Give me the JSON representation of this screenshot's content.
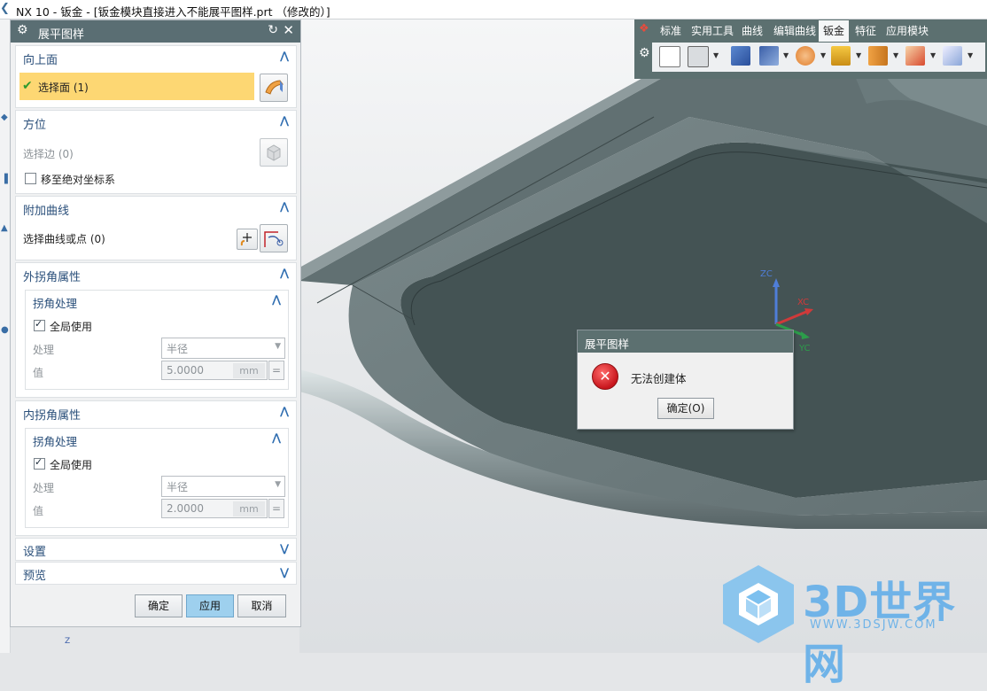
{
  "window": {
    "title": "NX 10 - 钣金 - [钣金模块直接进入不能展平图样.prt （修改的）]"
  },
  "dialog": {
    "title": "展平图样",
    "sections": {
      "up_face": {
        "label": "向上面",
        "select_label": "选择面 (1)"
      },
      "orientation": {
        "label": "方位",
        "select_edge": "选择边 (0)",
        "move_abs": "移至绝对坐标系"
      },
      "extra_curves": {
        "label": "附加曲线",
        "select_curve": "选择曲线或点 (0)"
      },
      "outer_corner": {
        "label": "外拐角属性",
        "sub_label": "拐角处理",
        "global_use": "全局使用",
        "process_label": "处理",
        "process_value": "半径",
        "value_label": "值",
        "value": "5.0000",
        "unit": "mm"
      },
      "inner_corner": {
        "label": "内拐角属性",
        "sub_label": "拐角处理",
        "global_use": "全局使用",
        "process_label": "处理",
        "process_value": "半径",
        "value_label": "值",
        "value": "2.0000",
        "unit": "mm"
      },
      "settings": {
        "label": "设置"
      },
      "preview": {
        "label": "预览"
      }
    },
    "buttons": {
      "ok": "确定",
      "apply": "应用",
      "cancel": "取消"
    }
  },
  "toolbar": {
    "tabs": [
      "标准",
      "实用工具",
      "曲线",
      "编辑曲线",
      "钣金",
      "特征",
      "应用模块"
    ],
    "active_tab": "钣金"
  },
  "error_dialog": {
    "title": "展平图样",
    "message": "无法创建体",
    "button": "确定(O)"
  },
  "axes": {
    "z": "ZC",
    "x": "XC",
    "y": "YC",
    "bottom_z": "Z"
  },
  "watermark": {
    "main": "3D世界网",
    "url": "WWW.3DSJW.COM"
  },
  "colors": {
    "accent": "#5c7070",
    "selection": "#fdd773",
    "model": "#4b5b5c",
    "primary_button": "#9ed0ee"
  }
}
